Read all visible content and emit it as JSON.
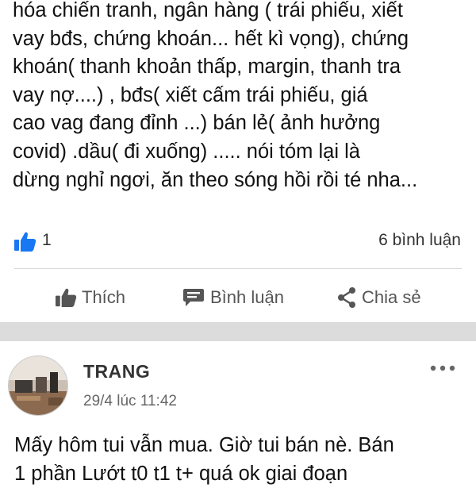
{
  "post": {
    "lines": [
      "hóa chiến tranh,  ngân hàng ( trái phiếu,  xiết",
      "vay bđs, chứng khoán... hết kì vọng),  chứng",
      "khoán( thanh khoản thấp, margin, thanh tra",
      "vay nợ....) , bđs(  xiết cấm  trái phiếu,  giá",
      "cao vag đang  đỉnh ...)  bán lẻ( ảnh hưởng",
      "covid) .dầu( đi xuống) ..... nói tóm lại  là",
      "dừng nghỉ ngơi, ăn theo sóng hồi rồi té nha..."
    ],
    "like_count": "1",
    "comment_count": "6 bình luận"
  },
  "actions": {
    "like_label": "Thích",
    "comment_label": "Bình luận",
    "share_label": "Chia sẻ"
  },
  "comment": {
    "author": "TRANG",
    "timestamp": "29/4 lúc 11:42",
    "lines": [
      "Mấy hôm tui vẫn mua. Giờ  tui bán  nè. Bán",
      "1 phần  Lướt t0 t1 t+    quá ok giai đoạn"
    ]
  },
  "colors": {
    "accent": "#1877f2",
    "action_icon": "#555555",
    "separator": "#dcdcdc"
  },
  "icons": {
    "like_badge": "thumbs-up-icon",
    "like_action": "thumbs-up-icon",
    "comment_action": "comment-icon",
    "share_action": "share-icon",
    "more": "more-icon"
  }
}
